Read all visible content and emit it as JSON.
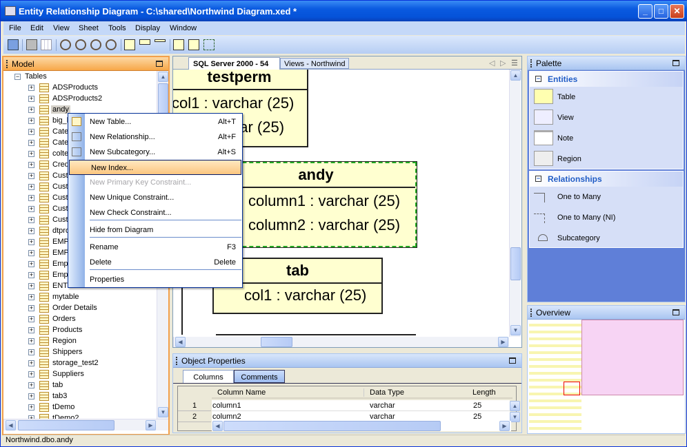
{
  "window": {
    "title": "Entity Relationship Diagram - C:\\shared\\Northwind Diagram.xed *"
  },
  "menu": [
    "File",
    "Edit",
    "View",
    "Sheet",
    "Tools",
    "Display",
    "Window"
  ],
  "toolbar": [
    "save-icon",
    "print-icon",
    "grid-icon",
    "zoom-actual-icon",
    "zoom-in-icon",
    "zoom-out-icon",
    "zoom-fit-icon",
    "table-icon",
    "view-icon",
    "note-icon",
    "table-detail-icon",
    "table-header-icon",
    "relationship-icon"
  ],
  "model": {
    "title": "Model",
    "root": "Tables",
    "items": [
      "ADSProducts",
      "ADSProducts2",
      "andy",
      "big_b",
      "Cate",
      "Cate",
      "colte",
      "Cred",
      "Cust",
      "Cust",
      "Cust",
      "Cust",
      "Cust",
      "dtpro",
      "EMPL",
      "EMPL",
      "Emplo",
      "Emplo",
      "ENTI",
      "mytable",
      "Order Details",
      "Orders",
      "Products",
      "Region",
      "Shippers",
      "storage_test2",
      "Suppliers",
      "tab",
      "tab3",
      "tDemo",
      "tDemo2"
    ],
    "selected": "andy"
  },
  "context_menu": {
    "items": [
      {
        "label": "New Table...",
        "shortcut": "Alt+T",
        "icon": "table-icon"
      },
      {
        "label": "New Relationship...",
        "shortcut": "Alt+F",
        "icon": "relationship-icon"
      },
      {
        "label": "New Subcategory...",
        "shortcut": "Alt+S",
        "icon": "subcategory-icon"
      },
      {
        "label": "New Index...",
        "shortcut": "",
        "highlighted": true
      },
      {
        "label": "New Primary Key Constraint...",
        "shortcut": "",
        "disabled": true
      },
      {
        "label": "New Unique Constraint...",
        "shortcut": ""
      },
      {
        "label": "New Check Constraint...",
        "shortcut": ""
      },
      {
        "label": "Hide from Diagram",
        "shortcut": ""
      },
      {
        "label": "Rename",
        "shortcut": "F3"
      },
      {
        "label": "Delete",
        "shortcut": "Delete"
      },
      {
        "label": "Properties",
        "shortcut": ""
      }
    ]
  },
  "diagram": {
    "tabs": [
      "SQL Server 2000 - 54",
      "Views - Northwind"
    ],
    "entities": [
      {
        "name": "testperm",
        "columns": [
          "col1 : varchar (25)",
          "har (25)"
        ]
      },
      {
        "name": "andy",
        "columns": [
          "column1 : varchar (25)",
          "column2 : varchar (25)"
        ]
      },
      {
        "name": "tab",
        "columns": [
          "col1 : varchar (25)"
        ]
      }
    ]
  },
  "properties": {
    "title": "Object Properties",
    "tabs": [
      "Columns",
      "Comments"
    ],
    "headers": [
      "Column Name",
      "Data Type",
      "Length"
    ],
    "rows": [
      [
        "1",
        "column1",
        "varchar",
        "25"
      ],
      [
        "2",
        "column2",
        "varchar",
        "25"
      ]
    ]
  },
  "palette": {
    "title": "Palette",
    "groups": [
      {
        "name": "Entities",
        "items": [
          "Table",
          "View",
          "Note",
          "Region"
        ]
      },
      {
        "name": "Relationships",
        "items": [
          "One to Many",
          "One to Many (NI)",
          "Subcategory"
        ]
      }
    ]
  },
  "overview": {
    "title": "Overview"
  },
  "status": "Northwind.dbo.andy"
}
